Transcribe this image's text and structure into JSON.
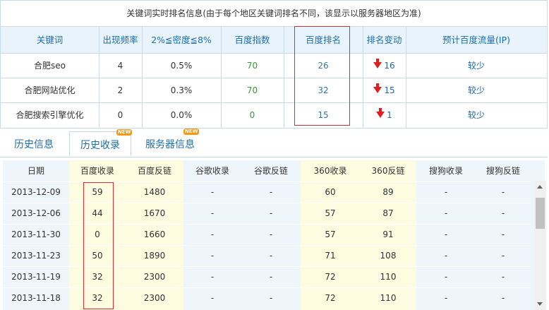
{
  "ranking": {
    "title": "关键词实时排名信息(由于每个地区关键词排名不同，该显示以服务器地区为准)",
    "headers": [
      "关键词",
      "出现频率",
      "2%≦密度≦8%",
      "百度指数",
      "百度排名",
      "排名变动",
      "预计百度流量(IP)"
    ],
    "rows": [
      {
        "keyword": "合肥seo",
        "freq": "4",
        "density": "0.5%",
        "index": "70",
        "rank": "26",
        "change": "16",
        "traffic": "较少"
      },
      {
        "keyword": "合肥网站优化",
        "freq": "2",
        "density": "0.3%",
        "index": "70",
        "rank": "32",
        "change": "15",
        "traffic": "较少"
      },
      {
        "keyword": "合肥搜索引擎优化",
        "freq": "0",
        "density": "0.0%",
        "index": "0",
        "rank": "15",
        "change": "1",
        "traffic": "较少"
      }
    ]
  },
  "tabs": [
    {
      "label": "历史信息",
      "new": ""
    },
    {
      "label": "历史收录",
      "new": "NEW"
    },
    {
      "label": "服务器信息",
      "new": "NEW"
    }
  ],
  "history": {
    "headers": [
      "日期",
      "百度收录",
      "百度反链",
      "谷歌收录",
      "谷歌反链",
      "360收录",
      "360反链",
      "搜狗收录",
      "搜狗反链"
    ],
    "rows": [
      [
        "2013-12-09",
        "59",
        "1480",
        "-",
        "-",
        "60",
        "89",
        "-",
        "-"
      ],
      [
        "2013-12-06",
        "44",
        "1670",
        "-",
        "-",
        "57",
        "87",
        "-",
        "-"
      ],
      [
        "2013-11-30",
        "0",
        "1660",
        "-",
        "-",
        "57",
        "91",
        "-",
        "-"
      ],
      [
        "2013-11-23",
        "50",
        "1890",
        "-",
        "-",
        "71",
        "108",
        "-",
        "-"
      ],
      [
        "2013-11-19",
        "32",
        "2300",
        "-",
        "-",
        "72",
        "110",
        "-",
        "-"
      ],
      [
        "2013-11-18",
        "32",
        "2300",
        "-",
        "-",
        "72",
        "110",
        "-",
        "-"
      ]
    ]
  },
  "colors": {
    "border": "#c9dbe9",
    "header_bg": "#e9f3fb",
    "highlight_col": "#fdfbe0",
    "red_box": "#d9302f",
    "down_arrow": "#e02020"
  }
}
